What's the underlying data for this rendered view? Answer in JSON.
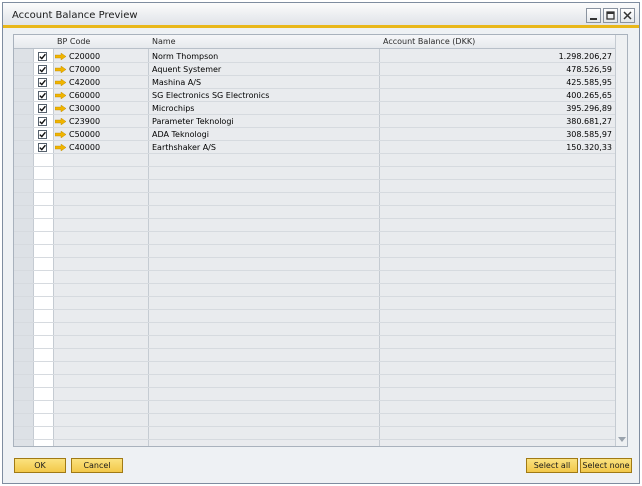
{
  "window": {
    "title": "Account Balance Preview"
  },
  "table": {
    "headers": {
      "bp_code": "BP Code",
      "name": "Name",
      "balance": "Account Balance (DKK)"
    },
    "rows": [
      {
        "checked": true,
        "code": "C20000",
        "name": "Norm Thompson",
        "balance": "1.298.206,27"
      },
      {
        "checked": true,
        "code": "C70000",
        "name": "Aquent Systemer",
        "balance": "478.526,59"
      },
      {
        "checked": true,
        "code": "C42000",
        "name": "Mashina A/S",
        "balance": "425.585,95"
      },
      {
        "checked": true,
        "code": "C60000",
        "name": "SG Electronics SG Electronics",
        "balance": "400.265,65"
      },
      {
        "checked": true,
        "code": "C30000",
        "name": "Microchips",
        "balance": "395.296,89"
      },
      {
        "checked": true,
        "code": "C23900",
        "name": "Parameter Teknologi",
        "balance": "380.681,27"
      },
      {
        "checked": true,
        "code": "C50000",
        "name": "ADA Teknologi",
        "balance": "308.585,97"
      },
      {
        "checked": true,
        "code": "C40000",
        "name": "Earthshaker A/S",
        "balance": "150.320,33"
      }
    ]
  },
  "buttons": {
    "ok": "OK",
    "cancel": "Cancel",
    "select_all": "Select all",
    "select_none": "Select none"
  },
  "colors": {
    "accent": "#e9b71a",
    "button": "#f2c84a",
    "link_arrow": "#f0b400"
  },
  "icons": {
    "row_link": "link-arrow-icon",
    "checkbox": "checkmark-icon"
  }
}
